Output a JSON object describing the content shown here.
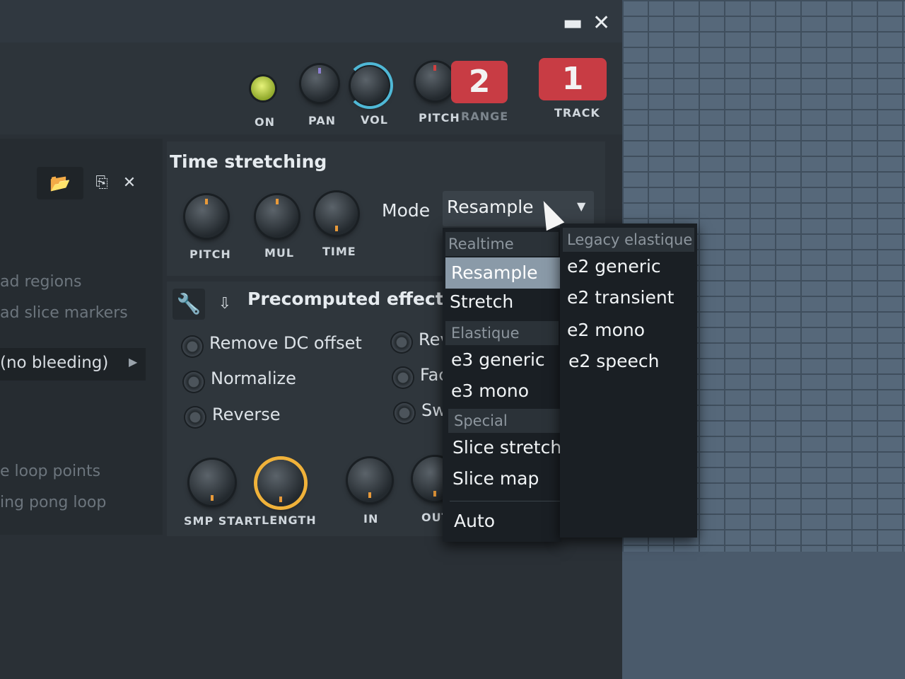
{
  "window": {
    "minimize_icon": "minimize-icon",
    "close_icon": "close-icon",
    "minimize_glyph": "▬",
    "close_glyph": "✕"
  },
  "channel": {
    "on_label": "ON",
    "pan_label": "PAN",
    "vol_label": "VOL",
    "pitch_label": "PITCH",
    "range_label": "RANGE",
    "range_value": "2",
    "track_label": "TRACK",
    "track_value": "1"
  },
  "sidebar": {
    "items": [
      "ad regions",
      "ad slice markers"
    ],
    "select_value": "(no bleeding)",
    "loop_items": [
      "e loop points",
      "ing pong loop"
    ]
  },
  "time_stretching": {
    "title": "Time stretching",
    "knobs": [
      "PITCH",
      "MUL",
      "TIME"
    ],
    "mode_label": "Mode",
    "mode_value": "Resample"
  },
  "precomputed": {
    "title": "Precomputed effects",
    "options_left": [
      "Remove DC offset",
      "Normalize",
      "Reverse"
    ],
    "options_right": [
      "Rev",
      "Fac",
      "Sw"
    ],
    "knobs": [
      "SMP START",
      "LENGTH",
      "IN",
      "OUT"
    ]
  },
  "mode_menu": {
    "col1": [
      {
        "type": "header",
        "label": "Realtime"
      },
      {
        "type": "item",
        "label": "Resample",
        "selected": true
      },
      {
        "type": "item",
        "label": "Stretch"
      },
      {
        "type": "header",
        "label": "Elastique"
      },
      {
        "type": "item",
        "label": "e3 generic"
      },
      {
        "type": "item",
        "label": "e3 mono"
      },
      {
        "type": "header",
        "label": "Special"
      },
      {
        "type": "item",
        "label": "Slice stretch"
      },
      {
        "type": "item",
        "label": "Slice map"
      },
      {
        "type": "item",
        "label": "Auto"
      }
    ],
    "col2": [
      {
        "type": "header",
        "label": "Legacy elastique"
      },
      {
        "type": "item",
        "label": "e2 generic"
      },
      {
        "type": "item",
        "label": "e2 transient"
      },
      {
        "type": "item",
        "label": "e2 mono"
      },
      {
        "type": "item",
        "label": "e2 speech"
      }
    ]
  },
  "colors": {
    "accent_orange": "#e89a3a",
    "vol_ring": "#4fb8d6",
    "counter_red": "#c83c44",
    "led_green": "#c8d84a"
  }
}
